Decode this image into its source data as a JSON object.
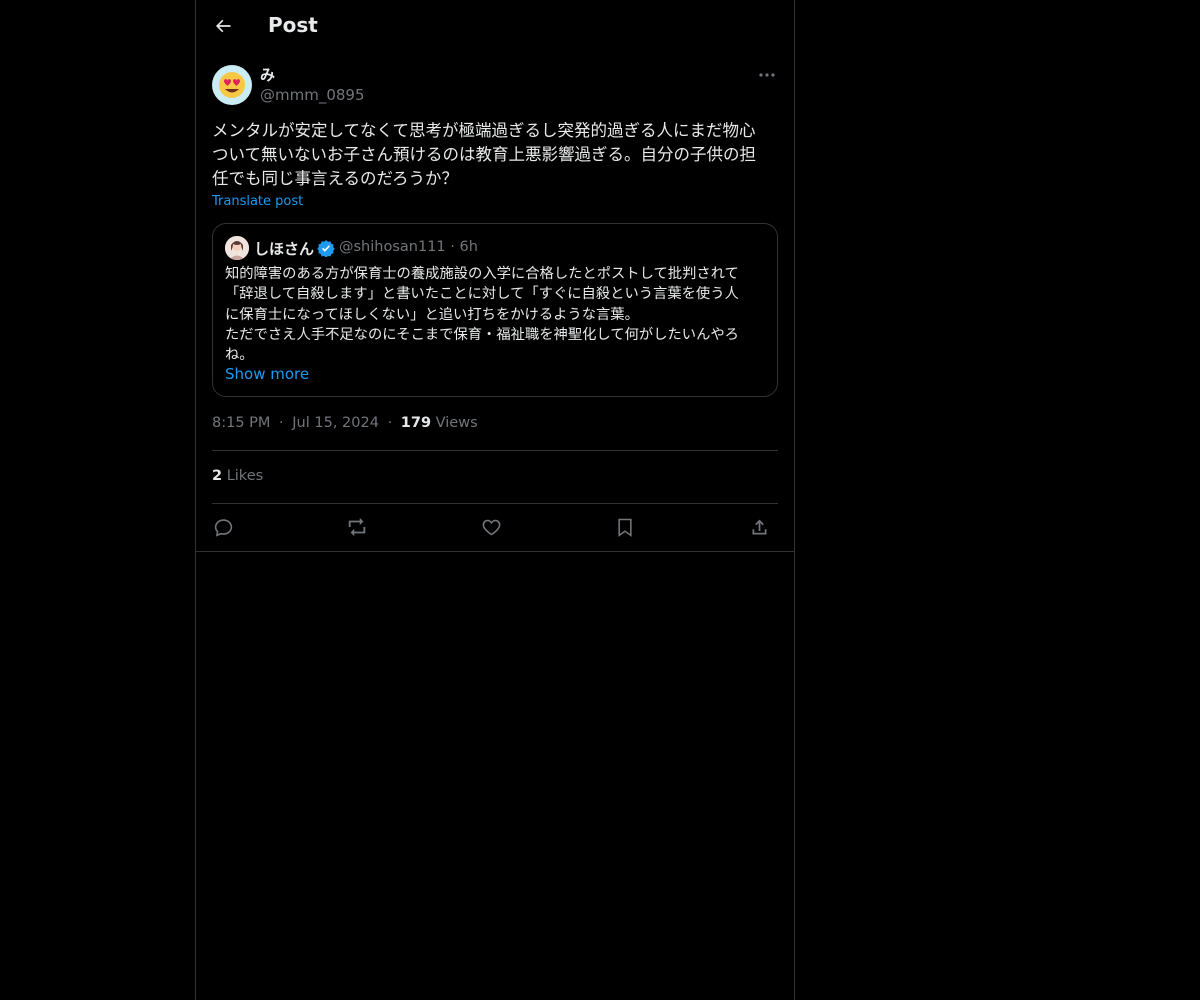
{
  "header": {
    "title": "Post"
  },
  "post": {
    "display_name": "み",
    "handle": "@mmm_0895",
    "text": "メンタルが安定してなくて思考が極端過ぎるし突発的過ぎる人にまだ物心\nついて無いないお子さん預けるのは教育上悪影響過ぎる。自分の子供の担\n任でも同じ事言えるのだろうか？",
    "translate_label": "Translate post",
    "avatar_icon": "heart-eyes-emoji-icon"
  },
  "quote": {
    "display_name": "しほさん",
    "handle": "@shihosan111",
    "time": "· 6h",
    "text": "知的障害のある方が保育士の養成施設の入学に合格したとポストして批判されて\n「辞退して自殺します」と書いたことに対して「すぐに自殺という言葉を使う人\nに保育士になってほしくない」と追い打ちをかけるような言葉。\nただでさえ人手不足なのにそこまで保育・福祉職を神聖化して何がしたいんやろ\nね。",
    "show_more": "Show more"
  },
  "meta": {
    "time": "8:15 PM",
    "sep1": "·",
    "date": "Jul 15, 2024",
    "sep2": "·",
    "views_count": "179",
    "views_label": "Views"
  },
  "stats": {
    "likes_count": "2",
    "likes_label": "Likes"
  },
  "colors": {
    "background": "#000000",
    "text": "#e7e9ea",
    "secondary": "#71767b",
    "accent": "#1d9bf0",
    "border": "#2f3336"
  }
}
